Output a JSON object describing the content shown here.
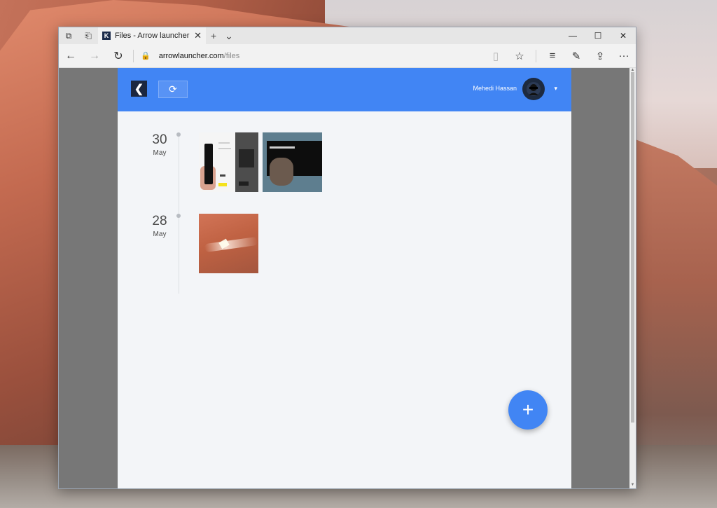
{
  "browser": {
    "tab": {
      "favicon": "K",
      "title": "Files - Arrow launcher"
    },
    "url": {
      "host": "arrowlauncher.com",
      "path": "/files"
    },
    "icons": {
      "back": "←",
      "forward": "→",
      "refresh": "↻",
      "lock": "🔒",
      "reading_view": "▯",
      "favorite": "☆",
      "hub": "≡",
      "notes": "✎",
      "share": "⇪",
      "more": "···",
      "new_tab": "+",
      "tab_list": "⌄",
      "tab_close": "✕",
      "minimize": "—",
      "maximize": "☐",
      "close": "✕",
      "set_aside": "⧉",
      "tab_preview": "⎗"
    }
  },
  "app": {
    "header": {
      "logo": "❮",
      "refresh_icon": "⟳",
      "user_name": "Mehedi Hassan",
      "caret": "▾",
      "accent_color": "#4185f4"
    },
    "timeline": [
      {
        "day": "30",
        "month": "May"
      },
      {
        "day": "28",
        "month": "May"
      }
    ],
    "fab": {
      "icon": "+"
    }
  }
}
